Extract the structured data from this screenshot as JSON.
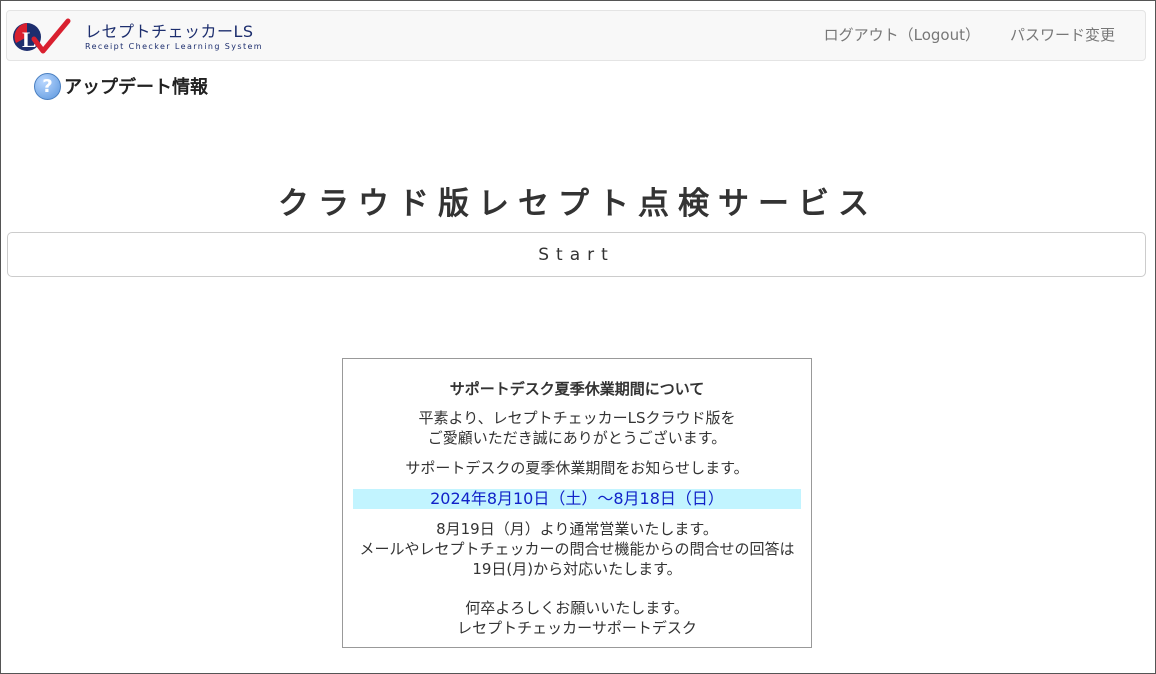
{
  "header": {
    "logo_title": "レセプトチェッカーLS",
    "logo_subtitle": "Receipt Checker Learning System",
    "logout_label": "ログアウト（Logout）",
    "password_change_label": "パスワード変更"
  },
  "update_link": {
    "icon": "question-icon",
    "label": "アップデート情報"
  },
  "main": {
    "service_title": "クラウド版レセプト点検サービス",
    "start_button_label": "Start"
  },
  "notice": {
    "title": "サポートデスク夏季休業期間について",
    "greeting": [
      "平素より、レセプトチェッカーLSクラウド版を",
      "ご愛顧いただき誠にありがとうございます。"
    ],
    "announcement": "サポートデスクの夏季休業期間をお知らせします。",
    "period": "2024年8月10日（土）～8月18日（日）",
    "resume": [
      "8月19日（月）より通常営業いたします。",
      "メールやレセプトチェッカーの問合せ機能からの問合せの回答は",
      "19日(月)から対応いたします。"
    ],
    "closing": [
      "何卒よろしくお願いいたします。",
      "レセプトチェッカーサポートデスク"
    ]
  },
  "colors": {
    "navbar_bg": "#f8f8f8",
    "logo_text": "#1d2e6e",
    "logo_red": "#d9202f",
    "period_highlight_bg": "#c2f4ff",
    "period_text": "#1022c8"
  }
}
